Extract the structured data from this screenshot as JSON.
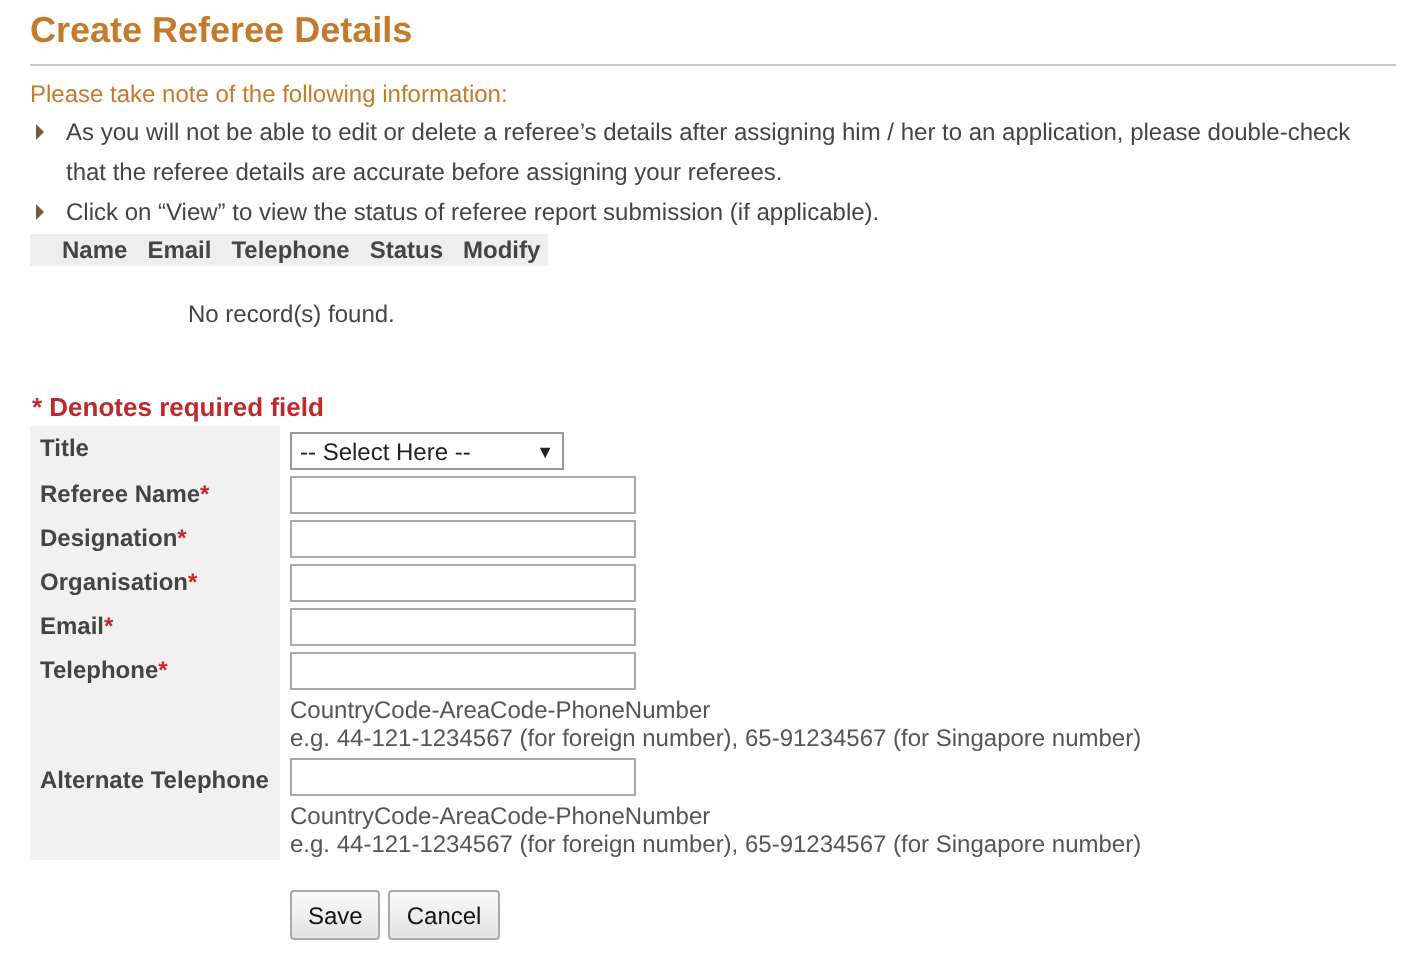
{
  "title": "Create Referee Details",
  "notice": {
    "heading": "Please take note of the following information:",
    "items": [
      "As you will not be able to edit or delete a referee’s details after assigning him / her to an application, please double-check that the referee details are accurate before assigning your referees.",
      "Click on “View” to view the status of referee report submission (if applicable)."
    ]
  },
  "table": {
    "columns": [
      "Name",
      "Email",
      "Telephone",
      "Status",
      "Modify"
    ],
    "empty_message": "No record(s) found."
  },
  "required_note": "* Denotes required field",
  "fields": [
    {
      "label": "Title",
      "kind": "select",
      "value": "-- Select Here --",
      "caret": "▼"
    },
    {
      "label": "Referee Name",
      "marker": "*",
      "kind": "text"
    },
    {
      "label": "Designation",
      "marker": "*",
      "kind": "text"
    },
    {
      "label": "Organisation",
      "marker": "*",
      "kind": "text"
    },
    {
      "label": "Email",
      "marker": "*",
      "kind": "text"
    },
    {
      "label": "Telephone",
      "marker": "*",
      "kind": "text",
      "hints": [
        "CountryCode-AreaCode-PhoneNumber",
        "e.g. 44-121-1234567 (for foreign number), 65-91234567 (for Singapore number)"
      ]
    },
    {
      "label": "Alternate Telephone",
      "kind": "text",
      "hints": [
        "CountryCode-AreaCode-PhoneNumber",
        "e.g. 44-121-1234567 (for foreign number), 65-91234567 (for Singapore number)"
      ]
    }
  ],
  "buttons": [
    "Save",
    "Cancel"
  ]
}
